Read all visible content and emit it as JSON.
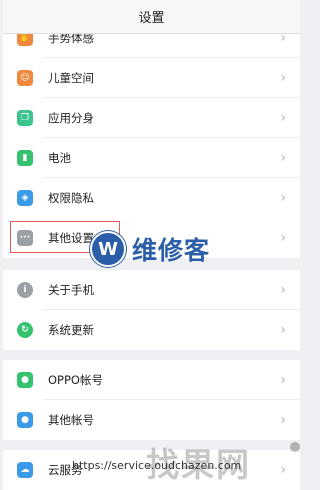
{
  "header": {
    "title": "设置"
  },
  "items": [
    {
      "label": "手势体感",
      "icon": "gesture-icon",
      "color": "#f0883e"
    },
    {
      "label": "儿童空间",
      "icon": "child-icon",
      "color": "#f0883e"
    },
    {
      "label": "应用分身",
      "icon": "app-clone-icon",
      "color": "#3cc48f"
    },
    {
      "label": "电池",
      "icon": "battery-icon",
      "color": "#34c26f"
    },
    {
      "label": "权限隐私",
      "icon": "privacy-shield-icon",
      "color": "#3c9be8"
    },
    {
      "label": "其他设置",
      "icon": "more-dots-icon",
      "color": "#9aa0a6"
    },
    {
      "label": "关于手机",
      "icon": "info-icon",
      "color": "#9aa0a6"
    },
    {
      "label": "系统更新",
      "icon": "update-icon",
      "color": "#34c26f"
    },
    {
      "label": "OPPO帐号",
      "icon": "account-icon",
      "color": "#34c26f"
    },
    {
      "label": "其他帐号",
      "icon": "other-account-icon",
      "color": "#3c9be8"
    },
    {
      "label": "云服务",
      "icon": "cloud-icon",
      "color": "#3c9be8"
    }
  ],
  "overlay": {
    "brand_logo_letter": "W",
    "brand_text": "维修客",
    "watermark_text": "找果网",
    "watermark_url": "https://service.oudchazen.com"
  }
}
